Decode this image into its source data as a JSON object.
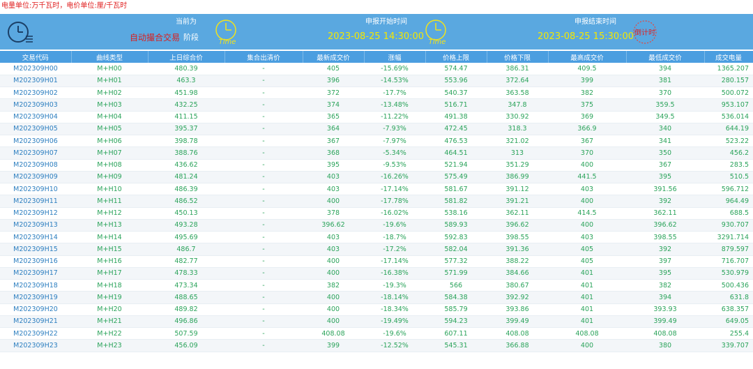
{
  "unit_note": "电量单位:万千瓦时，电价单位:厘/千瓦时",
  "header": {
    "current_label": "当前为",
    "current_state": "自动撮合交易",
    "stage_word": "阶段",
    "start_label": "申报开始时间",
    "start_time": "2023-08-25 14:30:00",
    "end_label": "申报结束时间",
    "end_time": "2023-08-25 15:30:00",
    "time_icon_text": "Time",
    "countdown_text": "倒计时"
  },
  "colors": {
    "banner": "#5aa8e0",
    "header_row": "#4b9ee0",
    "value_text": "#2aa35a",
    "code_text": "#2d7fc0",
    "alert": "#d82020",
    "time_text": "#f5e800"
  },
  "columns": [
    "交易代码",
    "曲线类型",
    "上日综合价",
    "集合出清价",
    "最新成交价",
    "涨幅",
    "价格上限",
    "价格下限",
    "最高成交价",
    "最低成交价",
    "成交电量"
  ],
  "rows": [
    [
      "M202309H00",
      "M+H00",
      "480.39",
      "-",
      "405",
      "-15.69%",
      "574.47",
      "386.31",
      "409.5",
      "394",
      "1365.207"
    ],
    [
      "M202309H01",
      "M+H01",
      "463.3",
      "-",
      "396",
      "-14.53%",
      "553.96",
      "372.64",
      "399",
      "381",
      "280.157"
    ],
    [
      "M202309H02",
      "M+H02",
      "451.98",
      "-",
      "372",
      "-17.7%",
      "540.37",
      "363.58",
      "382",
      "370",
      "500.072"
    ],
    [
      "M202309H03",
      "M+H03",
      "432.25",
      "-",
      "374",
      "-13.48%",
      "516.71",
      "347.8",
      "375",
      "359.5",
      "953.107"
    ],
    [
      "M202309H04",
      "M+H04",
      "411.15",
      "-",
      "365",
      "-11.22%",
      "491.38",
      "330.92",
      "369",
      "349.5",
      "536.014"
    ],
    [
      "M202309H05",
      "M+H05",
      "395.37",
      "-",
      "364",
      "-7.93%",
      "472.45",
      "318.3",
      "366.9",
      "340",
      "644.19"
    ],
    [
      "M202309H06",
      "M+H06",
      "398.78",
      "-",
      "367",
      "-7.97%",
      "476.53",
      "321.02",
      "367",
      "341",
      "523.22"
    ],
    [
      "M202309H07",
      "M+H07",
      "388.76",
      "-",
      "368",
      "-5.34%",
      "464.51",
      "313",
      "370",
      "350",
      "456.2"
    ],
    [
      "M202309H08",
      "M+H08",
      "436.62",
      "-",
      "395",
      "-9.53%",
      "521.94",
      "351.29",
      "400",
      "367",
      "283.5"
    ],
    [
      "M202309H09",
      "M+H09",
      "481.24",
      "-",
      "403",
      "-16.26%",
      "575.49",
      "386.99",
      "441.5",
      "395",
      "510.5"
    ],
    [
      "M202309H10",
      "M+H10",
      "486.39",
      "-",
      "403",
      "-17.14%",
      "581.67",
      "391.12",
      "403",
      "391.56",
      "596.712"
    ],
    [
      "M202309H11",
      "M+H11",
      "486.52",
      "-",
      "400",
      "-17.78%",
      "581.82",
      "391.21",
      "400",
      "392",
      "964.49"
    ],
    [
      "M202309H12",
      "M+H12",
      "450.13",
      "-",
      "378",
      "-16.02%",
      "538.16",
      "362.11",
      "414.5",
      "362.11",
      "688.5"
    ],
    [
      "M202309H13",
      "M+H13",
      "493.28",
      "-",
      "396.62",
      "-19.6%",
      "589.93",
      "396.62",
      "400",
      "396.62",
      "930.707"
    ],
    [
      "M202309H14",
      "M+H14",
      "495.69",
      "-",
      "403",
      "-18.7%",
      "592.83",
      "398.55",
      "403",
      "398.55",
      "3291.714"
    ],
    [
      "M202309H15",
      "M+H15",
      "486.7",
      "-",
      "403",
      "-17.2%",
      "582.04",
      "391.36",
      "405",
      "392",
      "879.597"
    ],
    [
      "M202309H16",
      "M+H16",
      "482.77",
      "-",
      "400",
      "-17.14%",
      "577.32",
      "388.22",
      "405",
      "397",
      "716.707"
    ],
    [
      "M202309H17",
      "M+H17",
      "478.33",
      "-",
      "400",
      "-16.38%",
      "571.99",
      "384.66",
      "401",
      "395",
      "530.979"
    ],
    [
      "M202309H18",
      "M+H18",
      "473.34",
      "-",
      "382",
      "-19.3%",
      "566",
      "380.67",
      "401",
      "382",
      "500.436"
    ],
    [
      "M202309H19",
      "M+H19",
      "488.65",
      "-",
      "400",
      "-18.14%",
      "584.38",
      "392.92",
      "401",
      "394",
      "631.8"
    ],
    [
      "M202309H20",
      "M+H20",
      "489.82",
      "-",
      "400",
      "-18.34%",
      "585.79",
      "393.86",
      "401",
      "393.93",
      "638.357"
    ],
    [
      "M202309H21",
      "M+H21",
      "496.86",
      "-",
      "400",
      "-19.49%",
      "594.23",
      "399.49",
      "401",
      "399.49",
      "649.05"
    ],
    [
      "M202309H22",
      "M+H22",
      "507.59",
      "-",
      "408.08",
      "-19.6%",
      "607.11",
      "408.08",
      "408.08",
      "408.08",
      "255.4"
    ],
    [
      "M202309H23",
      "M+H23",
      "456.09",
      "-",
      "399",
      "-12.52%",
      "545.31",
      "366.88",
      "400",
      "380",
      "339.707"
    ]
  ]
}
